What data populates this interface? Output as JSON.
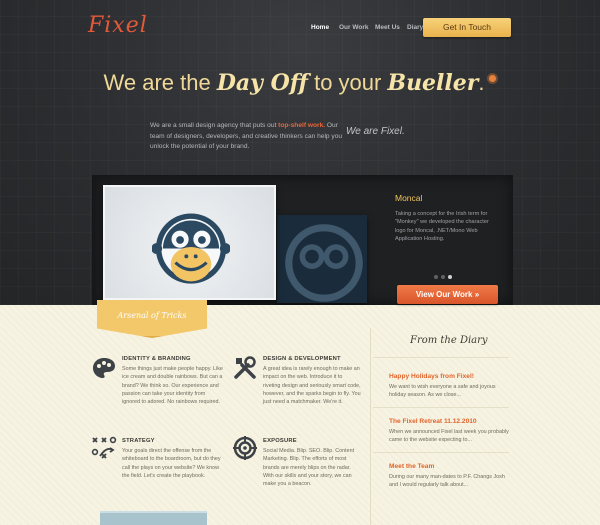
{
  "header": {
    "logo": "Fixel",
    "nav": [
      {
        "label": "Home",
        "active": true
      },
      {
        "label": "Our Work",
        "active": false
      },
      {
        "label": "Meet Us",
        "active": false
      },
      {
        "label": "Diary",
        "active": false
      }
    ],
    "cta": "Get In Touch"
  },
  "hero": {
    "headline_pre": "We are the ",
    "headline_script1": "Day Off",
    "headline_mid": " to your ",
    "headline_script2": "Bueller",
    "headline_end": ".",
    "intro_pre": "We are a small design agency that puts out ",
    "intro_highlight": "top-shelf work.",
    "intro_post": " Our team of designers, developers, and creative thinkers can help you unlock the potential of your brand.",
    "tagline": "We are Fixel."
  },
  "showcase": {
    "title": "Moncal",
    "description": "Taking a concept for the Irish term for \"Monkey\" we developed the character logo for Moncal, .NET/Mono Web Application Hosting.",
    "cta": "View Our Work »",
    "dots_active_index": 2
  },
  "arsenal": {
    "ribbon": "Arsenal of Tricks",
    "features": [
      {
        "icon": "palette-icon",
        "title": "IDENTITY & BRANDING",
        "text": "Some things just make people happy. Like ice cream and double rainbows. But can a brand? We think so. Our experience and passion can take your identity from ignored to adored. No rainbows required."
      },
      {
        "icon": "tools-icon",
        "title": "DESIGN & DEVELOPMENT",
        "text": "A great idea is rarely enough to make an impact on the web. Introduce it to riveting design and seriously smart code, however, and the sparks begin to fly. You just need a matchmaker. We're it."
      },
      {
        "icon": "strategy-icon",
        "title": "STRATEGY",
        "text": "Your goals direct the offense from the whiteboard to the boardroom, but do they call the plays on your website? We know the field. Let's create the playbook."
      },
      {
        "icon": "target-icon",
        "title": "EXPOSURE",
        "text": "Social Media. Blip. SEO. Blip. Content Marketing. Blip. The efforts of most brands are merely blips on the radar. With our skills and your story, we can make you a beacon."
      }
    ]
  },
  "diary": {
    "heading": "From the Diary",
    "posts": [
      {
        "title": "Happy Holidays from Fixel!",
        "excerpt": "We want to wish everyone a safe and joyous holiday season. As we close..."
      },
      {
        "title": "The Fixel Retreat 11.12.2010",
        "excerpt": "When we announced Fixel last week you probably came to the website expecting to..."
      },
      {
        "title": "Meet the Team",
        "excerpt": "During our many man-dates to P.F. Changs Josh and I would regularly talk about..."
      }
    ]
  },
  "colors": {
    "accent_orange": "#e0662d",
    "gold": "#f2c86b",
    "dark_bg": "#2b2d2f",
    "light_bg": "#f7f3e2"
  }
}
